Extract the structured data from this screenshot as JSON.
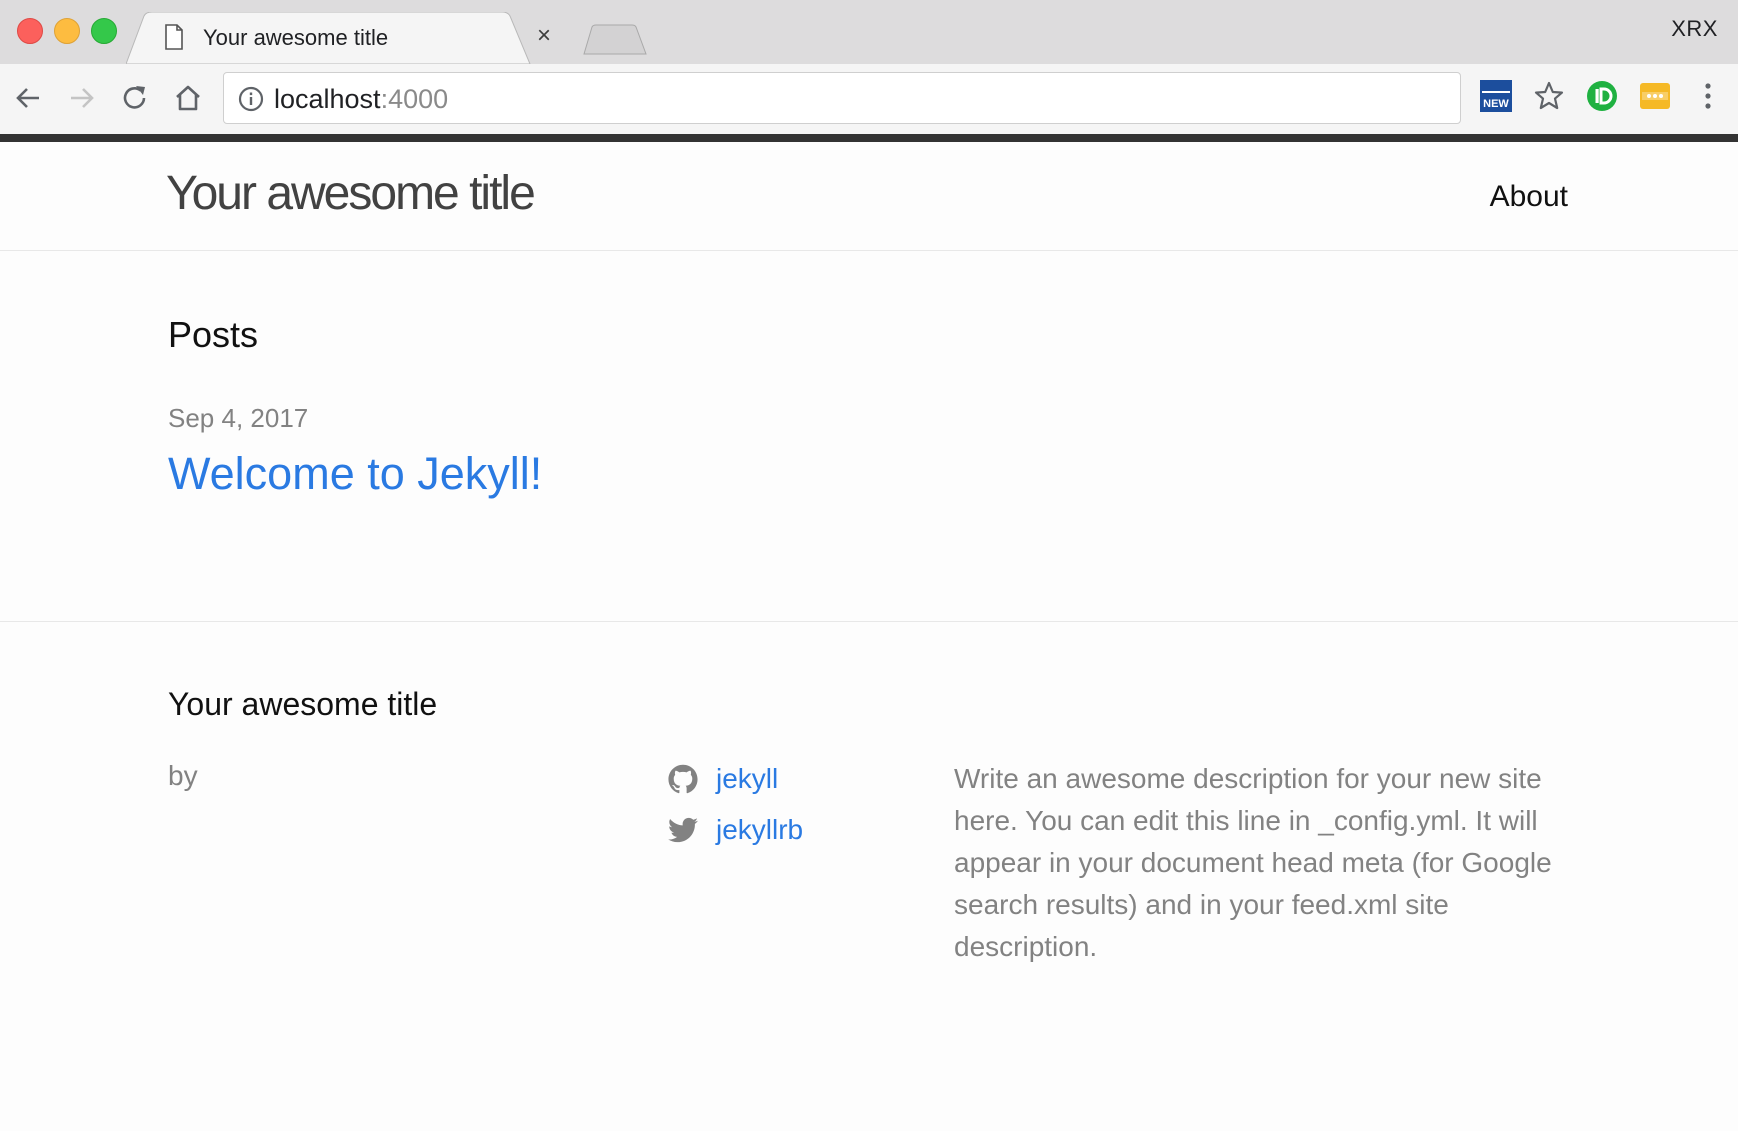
{
  "browser": {
    "tab_title": "Your awesome title",
    "tab_close": "×",
    "profile_name": "XRX",
    "url_host": "localhost",
    "url_port": ":4000",
    "extension_badge": "NEW"
  },
  "site": {
    "title": "Your awesome title",
    "nav": {
      "about": "About"
    }
  },
  "main": {
    "heading": "Posts",
    "posts": [
      {
        "date": "Sep 4, 2017",
        "title": "Welcome to Jekyll!"
      }
    ]
  },
  "footer": {
    "title": "Your awesome title",
    "by": "by",
    "github_user": "jekyll",
    "twitter_user": "jekyllrb",
    "description": "Write an awesome description for your new site here. You can edit this line in _config.yml. It will appear in your document head meta (for Google search results) and in your feed.xml site description."
  },
  "colors": {
    "link": "#2a7ae2",
    "muted": "#828282",
    "chrome_bg": "#dddcdd",
    "toolbar_bg": "#f5f5f5",
    "dark_bar": "#333333"
  }
}
